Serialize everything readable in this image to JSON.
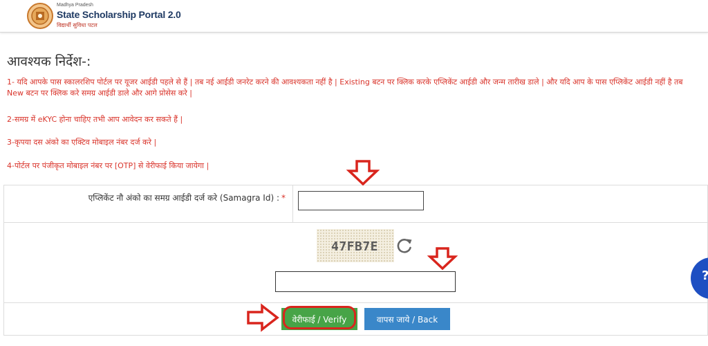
{
  "header": {
    "state": "Madhya Pradesh",
    "title": "State Scholarship Portal 2.0",
    "tagline": "विद्यार्थी सुविधा पटल"
  },
  "instructions": {
    "heading": "आवश्यक निर्देश-:",
    "items": [
      "1- यदि आपके पास स्कालरशिप पोर्टल पर यूजर आईडी पहले से हैं | तब नई आईडी जनरेट करने की आवश्यकता नहीं है | Existing बटन पर क्लिक करके एप्लिकेंट आईडी और जन्म तारीख डाले | और यदि आप के पास एप्लिकेंट आईडी नहीं है तब New बटन पर क्लिक करे समग्र आईडी डाले और आगे प्रोसेस करे |",
      "2-समग्र में eKYC होना चाहिए तभी आप आवेदन कर सकते हैं |",
      "3-कृपया दस अंको का एक्टिव मोबाइल नंबर दर्ज करे |",
      "4-पोर्टल पर पंजीकृत मोबाइल नंबर पर [OTP] से वेरीफाई किया जायेगा |"
    ]
  },
  "form": {
    "samagra_label": "एप्लिकेंट नौ अंको का समग्र आईडी दर्ज करे (Samagra Id) :",
    "required_mark": "*",
    "samagra_value": "",
    "captcha_text": "47FB7E",
    "captcha_value": ""
  },
  "buttons": {
    "verify": "वेरीफाई / Verify",
    "back": "वापस जाये / Back"
  },
  "colors": {
    "instruction_text": "#d9342b",
    "verify_button": "#47a447",
    "back_button": "#3a87c9",
    "annotation_red": "#d9251d",
    "chat_bubble": "#1e4fc2"
  },
  "icons": [
    "emblem-icon",
    "refresh-icon",
    "annotation-arrow-icon",
    "chat-icon"
  ]
}
